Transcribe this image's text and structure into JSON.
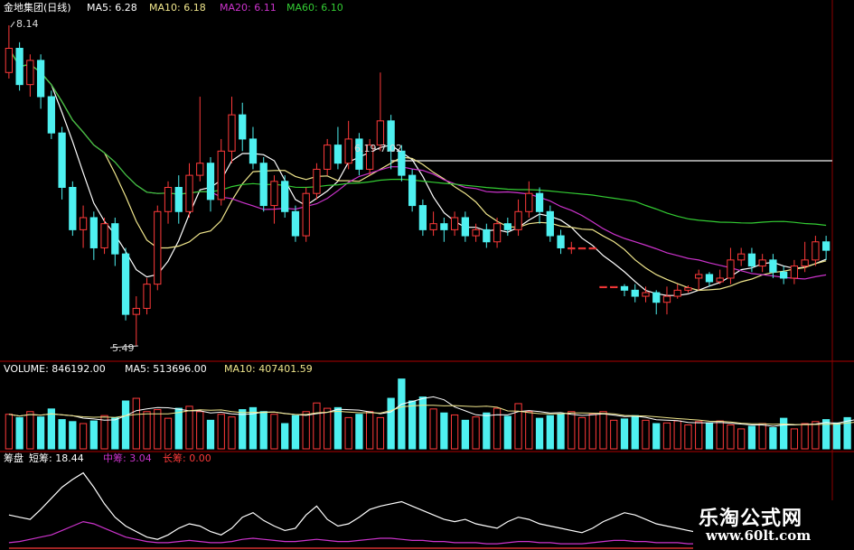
{
  "header": {
    "stock": "金地集团(日线)",
    "ma5": "MA5: 6.28",
    "ma10": "MA10: 6.18",
    "ma20": "MA20: 6.11",
    "ma60": "MA60: 6.10",
    "high_label": "8.14",
    "low_label": "5.49",
    "range_label": "6.19-7.02"
  },
  "volume_header": {
    "volume": "VOLUME: 846192.00",
    "ma5": "MA5: 513696.00",
    "ma10": "MA10: 407401.59"
  },
  "indicator_header": {
    "name": "筹盘",
    "short": "短筹: 18.44",
    "mid": "中筹: 3.04",
    "long": "长筹: 0.00"
  },
  "watermark": {
    "title": "乐淘公式网",
    "url": "www.60lt.com"
  },
  "colors": {
    "up": "#ff3a3a",
    "down": "#4ef0f0",
    "ma5": "#ffffff",
    "ma10": "#f0e68c",
    "ma20": "#cc33cc",
    "ma60": "#33cc33",
    "grid": "#8b0000"
  },
  "chart_data": [
    {
      "type": "candlestick",
      "title": "金地集团(日线)",
      "high": 8.14,
      "low": 5.49,
      "range_line": [
        6.19,
        7.02
      ],
      "ylim": [
        5.4,
        8.2
      ],
      "candles": [
        {
          "o": 7.75,
          "c": 7.95,
          "h": 8.14,
          "l": 7.7
        },
        {
          "o": 7.95,
          "c": 7.65,
          "h": 8.0,
          "l": 7.6
        },
        {
          "o": 7.65,
          "c": 7.85,
          "h": 7.9,
          "l": 7.55
        },
        {
          "o": 7.85,
          "c": 7.55,
          "h": 7.9,
          "l": 7.45
        },
        {
          "o": 7.55,
          "c": 7.25,
          "h": 7.6,
          "l": 7.2
        },
        {
          "o": 7.25,
          "c": 6.8,
          "h": 7.3,
          "l": 6.7
        },
        {
          "o": 6.8,
          "c": 6.45,
          "h": 6.85,
          "l": 6.4
        },
        {
          "o": 6.45,
          "c": 6.55,
          "h": 6.65,
          "l": 6.3
        },
        {
          "o": 6.55,
          "c": 6.3,
          "h": 6.6,
          "l": 6.2
        },
        {
          "o": 6.3,
          "c": 6.5,
          "h": 6.55,
          "l": 6.25
        },
        {
          "o": 6.5,
          "c": 6.25,
          "h": 6.55,
          "l": 6.15
        },
        {
          "o": 6.25,
          "c": 5.75,
          "h": 6.3,
          "l": 5.7
        },
        {
          "o": 5.75,
          "c": 5.8,
          "h": 5.9,
          "l": 5.49
        },
        {
          "o": 5.8,
          "c": 6.0,
          "h": 6.05,
          "l": 5.75
        },
        {
          "o": 6.0,
          "c": 6.6,
          "h": 6.65,
          "l": 5.95
        },
        {
          "o": 6.6,
          "c": 6.8,
          "h": 6.85,
          "l": 6.5
        },
        {
          "o": 6.8,
          "c": 6.6,
          "h": 6.9,
          "l": 6.5
        },
        {
          "o": 6.6,
          "c": 6.9,
          "h": 7.0,
          "l": 6.55
        },
        {
          "o": 6.9,
          "c": 7.0,
          "h": 7.55,
          "l": 6.85
        },
        {
          "o": 7.0,
          "c": 6.7,
          "h": 7.05,
          "l": 6.6
        },
        {
          "o": 6.7,
          "c": 7.1,
          "h": 7.2,
          "l": 6.65
        },
        {
          "o": 7.1,
          "c": 7.4,
          "h": 7.55,
          "l": 7.0
        },
        {
          "o": 7.4,
          "c": 7.2,
          "h": 7.5,
          "l": 7.1
        },
        {
          "o": 7.2,
          "c": 7.0,
          "h": 7.3,
          "l": 6.95
        },
        {
          "o": 7.0,
          "c": 6.65,
          "h": 7.05,
          "l": 6.6
        },
        {
          "o": 6.65,
          "c": 6.85,
          "h": 6.9,
          "l": 6.5
        },
        {
          "o": 6.85,
          "c": 6.6,
          "h": 6.9,
          "l": 6.55
        },
        {
          "o": 6.6,
          "c": 6.4,
          "h": 6.65,
          "l": 6.35
        },
        {
          "o": 6.4,
          "c": 6.75,
          "h": 6.8,
          "l": 6.35
        },
        {
          "o": 6.75,
          "c": 6.95,
          "h": 7.0,
          "l": 6.7
        },
        {
          "o": 6.95,
          "c": 7.15,
          "h": 7.2,
          "l": 6.9
        },
        {
          "o": 7.15,
          "c": 7.0,
          "h": 7.3,
          "l": 6.95
        },
        {
          "o": 7.0,
          "c": 7.2,
          "h": 7.35,
          "l": 6.95
        },
        {
          "o": 7.2,
          "c": 6.95,
          "h": 7.25,
          "l": 6.9
        },
        {
          "o": 6.95,
          "c": 7.15,
          "h": 7.2,
          "l": 6.9
        },
        {
          "o": 7.15,
          "c": 7.35,
          "h": 7.75,
          "l": 7.1
        },
        {
          "o": 7.35,
          "c": 7.1,
          "h": 7.4,
          "l": 6.95
        },
        {
          "o": 7.1,
          "c": 6.9,
          "h": 7.15,
          "l": 6.85
        },
        {
          "o": 6.9,
          "c": 6.65,
          "h": 6.95,
          "l": 6.6
        },
        {
          "o": 6.65,
          "c": 6.45,
          "h": 6.7,
          "l": 6.4
        },
        {
          "o": 6.45,
          "c": 6.5,
          "h": 6.6,
          "l": 6.4
        },
        {
          "o": 6.5,
          "c": 6.45,
          "h": 6.55,
          "l": 6.35
        },
        {
          "o": 6.45,
          "c": 6.55,
          "h": 6.6,
          "l": 6.4
        },
        {
          "o": 6.55,
          "c": 6.4,
          "h": 6.6,
          "l": 6.35
        },
        {
          "o": 6.4,
          "c": 6.45,
          "h": 6.5,
          "l": 6.35
        },
        {
          "o": 6.45,
          "c": 6.35,
          "h": 6.5,
          "l": 6.3
        },
        {
          "o": 6.35,
          "c": 6.5,
          "h": 6.55,
          "l": 6.3
        },
        {
          "o": 6.5,
          "c": 6.45,
          "h": 6.55,
          "l": 6.4
        },
        {
          "o": 6.45,
          "c": 6.6,
          "h": 6.7,
          "l": 6.4
        },
        {
          "o": 6.6,
          "c": 6.75,
          "h": 6.85,
          "l": 6.55
        },
        {
          "o": 6.75,
          "c": 6.6,
          "h": 6.8,
          "l": 6.5
        },
        {
          "o": 6.6,
          "c": 6.4,
          "h": 6.65,
          "l": 6.35
        },
        {
          "o": 6.4,
          "c": 6.3,
          "h": 6.45,
          "l": 6.25
        },
        {
          "o": 6.3,
          "c": 6.3,
          "h": 6.35,
          "l": 6.25
        },
        {
          "o": 6.3,
          "c": 6.3,
          "h": 6.3,
          "l": 6.3
        },
        {
          "o": 6.3,
          "c": 6.3,
          "h": 6.3,
          "l": 6.3
        },
        {
          "o": 5.98,
          "c": 5.98,
          "h": 5.98,
          "l": 5.98
        },
        {
          "o": 5.98,
          "c": 5.98,
          "h": 5.98,
          "l": 5.98
        },
        {
          "o": 5.98,
          "c": 5.95,
          "h": 6.0,
          "l": 5.9
        },
        {
          "o": 5.95,
          "c": 5.9,
          "h": 6.0,
          "l": 5.85
        },
        {
          "o": 5.9,
          "c": 5.93,
          "h": 5.98,
          "l": 5.85
        },
        {
          "o": 5.93,
          "c": 5.85,
          "h": 5.95,
          "l": 5.75
        },
        {
          "o": 5.85,
          "c": 5.9,
          "h": 5.98,
          "l": 5.75
        },
        {
          "o": 5.9,
          "c": 5.95,
          "h": 6.0,
          "l": 5.88
        },
        {
          "o": 5.95,
          "c": 5.97,
          "h": 5.99,
          "l": 5.93
        },
        {
          "o": 6.05,
          "c": 6.08,
          "h": 6.12,
          "l": 5.95
        },
        {
          "o": 6.08,
          "c": 6.02,
          "h": 6.1,
          "l": 5.98
        },
        {
          "o": 6.02,
          "c": 6.05,
          "h": 6.12,
          "l": 6.0
        },
        {
          "o": 6.05,
          "c": 6.2,
          "h": 6.3,
          "l": 6.0
        },
        {
          "o": 6.2,
          "c": 6.25,
          "h": 6.3,
          "l": 6.15
        },
        {
          "o": 6.25,
          "c": 6.15,
          "h": 6.3,
          "l": 6.1
        },
        {
          "o": 6.15,
          "c": 6.2,
          "h": 6.25,
          "l": 6.1
        },
        {
          "o": 6.2,
          "c": 6.1,
          "h": 6.25,
          "l": 6.05
        },
        {
          "o": 6.1,
          "c": 6.05,
          "h": 6.15,
          "l": 6.0
        },
        {
          "o": 6.05,
          "c": 6.15,
          "h": 6.2,
          "l": 6.0
        },
        {
          "o": 6.15,
          "c": 6.2,
          "h": 6.35,
          "l": 6.1
        },
        {
          "o": 6.2,
          "c": 6.35,
          "h": 6.4,
          "l": 6.15
        },
        {
          "o": 6.35,
          "c": 6.28,
          "h": 6.4,
          "l": 6.2
        }
      ],
      "ma_values": {
        "MA5": 6.28,
        "MA10": 6.18,
        "MA20": 6.11,
        "MA60": 6.1
      }
    },
    {
      "type": "bar",
      "title": "VOLUME",
      "current": 846192.0,
      "ma5": 513696.0,
      "ma10": 407401.59,
      "values": [
        520,
        470,
        560,
        480,
        600,
        440,
        410,
        380,
        420,
        500,
        470,
        720,
        760,
        560,
        590,
        460,
        610,
        640,
        560,
        430,
        520,
        480,
        590,
        620,
        560,
        520,
        380,
        500,
        560,
        690,
        610,
        620,
        470,
        520,
        560,
        470,
        760,
        1050,
        720,
        780,
        600,
        540,
        510,
        430,
        480,
        540,
        610,
        490,
        680,
        560,
        460,
        500,
        520,
        560,
        470,
        520,
        560,
        430,
        450,
        500,
        430,
        380,
        390,
        420,
        360,
        410,
        380,
        420,
        360,
        300,
        340,
        380,
        320,
        460,
        300,
        380,
        410,
        440,
        390,
        470,
        510,
        846
      ]
    },
    {
      "type": "line",
      "title": "筹盘",
      "series": [
        {
          "name": "短筹",
          "values": [
            30,
            28,
            26,
            35,
            45,
            55,
            62,
            68,
            55,
            40,
            28,
            20,
            15,
            10,
            8,
            12,
            18,
            22,
            20,
            15,
            12,
            18,
            28,
            32,
            25,
            20,
            16,
            18,
            30,
            38,
            26,
            20,
            22,
            28,
            35,
            38,
            40,
            42,
            38,
            34,
            30,
            26,
            24,
            26,
            22,
            20,
            18,
            24,
            28,
            26,
            22,
            20,
            18,
            16,
            14,
            18,
            24,
            28,
            32,
            30,
            26,
            22,
            20,
            18,
            16,
            14,
            12,
            16,
            18,
            20,
            24,
            26,
            22,
            20,
            18,
            16,
            18,
            20,
            22,
            24,
            26,
            18.44
          ]
        },
        {
          "name": "中筹",
          "values": [
            5,
            6,
            8,
            10,
            12,
            16,
            20,
            24,
            22,
            18,
            14,
            10,
            8,
            6,
            5,
            5,
            6,
            7,
            6,
            5,
            5,
            6,
            8,
            9,
            8,
            7,
            6,
            6,
            7,
            8,
            7,
            6,
            6,
            7,
            8,
            9,
            9,
            8,
            7,
            7,
            6,
            6,
            5,
            5,
            5,
            4,
            4,
            5,
            6,
            6,
            5,
            5,
            4,
            4,
            4,
            5,
            6,
            7,
            7,
            6,
            6,
            5,
            5,
            5,
            4,
            4,
            4,
            5,
            5,
            6,
            6,
            6,
            5,
            5,
            4,
            4,
            4,
            4,
            4,
            3,
            3,
            3.04
          ]
        },
        {
          "name": "长筹",
          "values": [
            0,
            0,
            0,
            0,
            0,
            0,
            0,
            0,
            0,
            0,
            0,
            0,
            0,
            0,
            0,
            0,
            0,
            0,
            0,
            0,
            0,
            0,
            0,
            0,
            0,
            0,
            0,
            0,
            0,
            0,
            0,
            0,
            0,
            0,
            0,
            0,
            0,
            0,
            0,
            0,
            0,
            0,
            0,
            0,
            0,
            0,
            0,
            0,
            0,
            0,
            0,
            0,
            0,
            0,
            0,
            0,
            0,
            0,
            0,
            0,
            0,
            0,
            0,
            0,
            0,
            0,
            0,
            0,
            0,
            0,
            0,
            0,
            0,
            0,
            0,
            0,
            0,
            0,
            0,
            0,
            0,
            0
          ]
        }
      ]
    }
  ]
}
